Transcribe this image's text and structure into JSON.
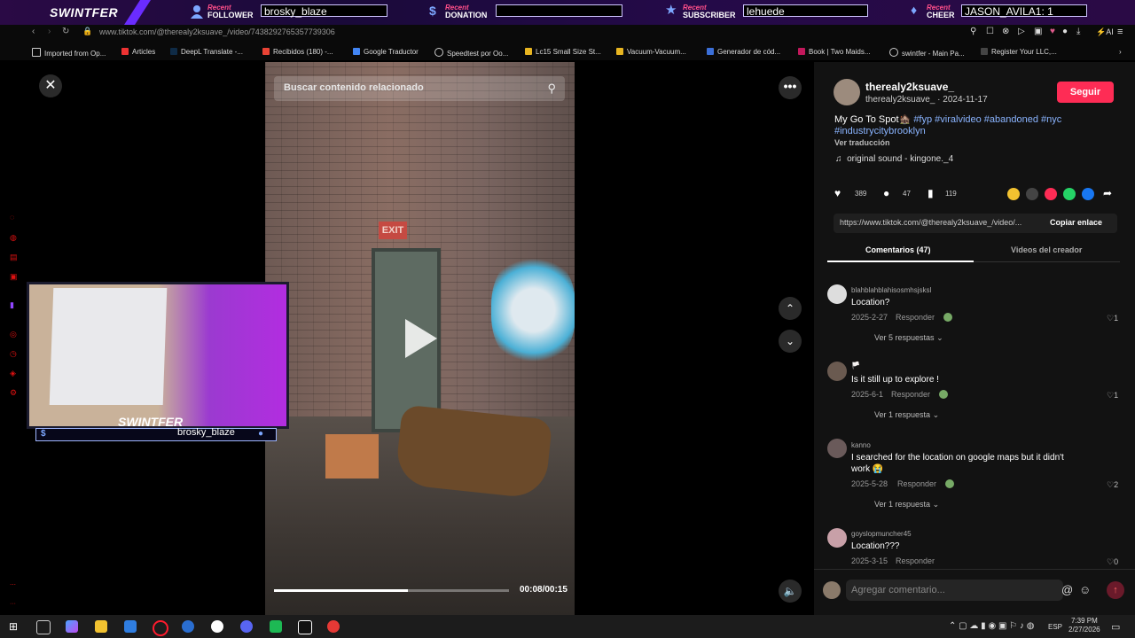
{
  "overlay": {
    "brand": "SWINTFER",
    "follower": {
      "recent": "Recent",
      "label": "FOLLOWER",
      "value": "brosky_blaze"
    },
    "donation": {
      "recent": "Recent",
      "label": "DONATION",
      "value": ""
    },
    "subscriber": {
      "recent": "Recent",
      "label": "SUBSCRIBER",
      "value": "lehuede"
    },
    "cheer": {
      "recent": "Recent",
      "label": "CHEER",
      "value": "JASON_AVILA1: 1"
    }
  },
  "browser": {
    "url": "www.tiktok.com/@therealy2ksuave_/video/7438292765357739306",
    "bookmarks": [
      "Imported from Op...",
      "Articles",
      "DeepL Translate -...",
      "Recibidos (180) -...",
      "Google Traductor",
      "Speedtest por Oo...",
      "Lc15 Small Size St...",
      "Vacuum-Vacuum...",
      "Generador de cód...",
      "Book | Two Maids...",
      "swintfer - Main Pa...",
      "Register Your LLC,..."
    ],
    "ai_label": "AI"
  },
  "video": {
    "search_placeholder": "Buscar contenido relacionado",
    "time": "00:08/00:15",
    "progress": 0.57,
    "sign": "EXIT"
  },
  "cam": {
    "brand": "SWINTFER",
    "name": "brosky_blaze"
  },
  "post": {
    "username": "therealy2ksuave_",
    "handle_date": "therealy2ksuave_ · 2024-11-17",
    "follow_label": "Seguir",
    "caption": "My Go To Spot🏚️",
    "hashtags_line1": "#fyp #viralvideo #abandoned #nyc",
    "hashtags_line2": "#industrycitybrooklyn",
    "translate": "Ver traducción",
    "sound": "original sound - kingone._4",
    "likes": "389",
    "comments": "47",
    "saves": "119",
    "link": "https://www.tiktok.com/@therealy2ksuave_/video/...",
    "copy_label": "Copiar enlace",
    "tab_comments": "Comentarios (47)",
    "tab_videos": "Videos del creador"
  },
  "comments": [
    {
      "user": "blahblahblahisosmhsjsksl",
      "text": "Location?",
      "date": "2025-2-27",
      "reply": "Responder",
      "likes": "1",
      "more": "Ver 5 respuestas"
    },
    {
      "user": "🏳️",
      "text": "Is it still up to explore !",
      "date": "2025-6-1",
      "reply": "Responder",
      "likes": "1",
      "more": "Ver 1 respuesta"
    },
    {
      "user": "kanno",
      "text": "I searched for the location on google maps but it didn't",
      "text2": "work 😭",
      "date": "2025-5-28",
      "reply": "Responder",
      "likes": "2",
      "more": "Ver 1 respuesta"
    },
    {
      "user": "goyslopmuncher45",
      "text": "Location???",
      "date": "2025-3-15",
      "reply": "Responder",
      "likes": "0"
    }
  ],
  "comment_input": {
    "placeholder": "Agregar comentario..."
  },
  "taskbar": {
    "lang": "ESP",
    "time": "7:39 PM",
    "date": "2/27/2026"
  },
  "colors": {
    "accent": "#fe2c55",
    "hashtag": "#8ab4ff",
    "overlay_purple": "#6a2cff"
  }
}
